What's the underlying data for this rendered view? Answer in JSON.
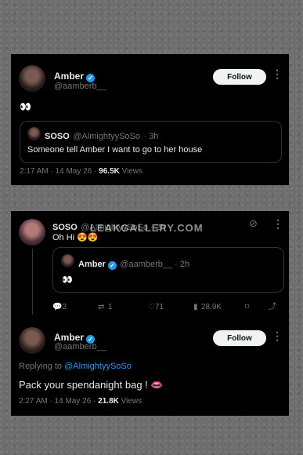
{
  "tweet1": {
    "name": "Amber",
    "handle": "@aamberb__",
    "follow_label": "Follow",
    "text": "👀",
    "quote": {
      "name": "SOSO",
      "handle": "@AlmightyySoSo",
      "time": "· 3h",
      "text": "Someone tell Amber I want to go to her house"
    },
    "timestamp": "2:17 AM · 14 May 26 ·",
    "views_count": "96.5K",
    "views_label": "Views"
  },
  "tweet2": {
    "name": "SOSO",
    "handle": "@AlmightyySoSo · 2h",
    "text": "Oh Hi 😍😍",
    "quote": {
      "name": "Amber",
      "handle": "@aamberb__ · 2h",
      "text": "👀"
    },
    "actions": {
      "replies": "2",
      "retweets": "1",
      "likes": "71",
      "views": "28.9K"
    }
  },
  "tweet3": {
    "name": "Amber",
    "handle": "@aamberb__",
    "follow_label": "Follow",
    "replying_prefix": "Replying to",
    "replying_to": "@AlmightyySoSo",
    "text": "Pack your spendanight bag ! 👄",
    "timestamp": "2:27 AM · 14 May 26 ·",
    "views_count": "21.8K",
    "views_label": "Views"
  },
  "watermark": "LEAKGALLERY.COM",
  "colors": {
    "accent": "#1d9bf0",
    "muted": "#71767b",
    "background": "#000000"
  }
}
